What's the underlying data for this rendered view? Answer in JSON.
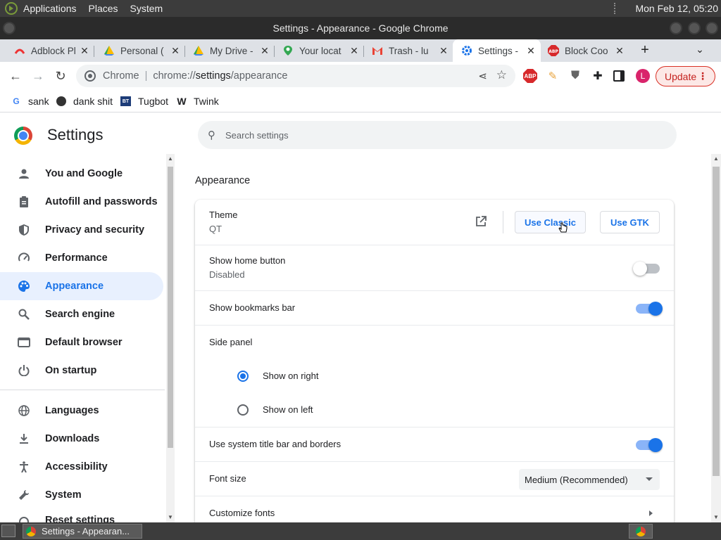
{
  "desktop": {
    "menus": [
      "Applications",
      "Places",
      "System"
    ],
    "clock": "Mon Feb 12, 05:20"
  },
  "window": {
    "title": "Settings - Appearance - Google Chrome"
  },
  "tabs": [
    {
      "label": "Adblock Pl",
      "icon": "adblock-icon"
    },
    {
      "label": "Personal (",
      "icon": "drive-icon"
    },
    {
      "label": "My Drive -",
      "icon": "drive-icon"
    },
    {
      "label": "Your locat",
      "icon": "maps-icon"
    },
    {
      "label": "Trash - lu",
      "icon": "gmail-icon"
    },
    {
      "label": "Settings -",
      "icon": "gear-icon",
      "active": true
    },
    {
      "label": "Block Coo",
      "icon": "abp-icon"
    }
  ],
  "toolbar": {
    "site_name": "Chrome",
    "url_scheme": "chrome://",
    "url_host": "settings",
    "url_path": "/appearance",
    "update_label": "Update",
    "avatar_letter": "L"
  },
  "bookmarks": [
    {
      "label": "sank",
      "icon": "google-icon"
    },
    {
      "label": "dank shit",
      "icon": "generic-icon"
    },
    {
      "label": "Tugbot",
      "icon": "bt-icon"
    },
    {
      "label": "Twink",
      "icon": "w-icon"
    }
  ],
  "settings": {
    "title": "Settings",
    "search_placeholder": "Search settings",
    "nav": [
      {
        "label": "You and Google",
        "icon": "person-icon"
      },
      {
        "label": "Autofill and passwords",
        "icon": "clipboard-icon"
      },
      {
        "label": "Privacy and security",
        "icon": "shield-icon"
      },
      {
        "label": "Performance",
        "icon": "speedometer-icon"
      },
      {
        "label": "Appearance",
        "icon": "palette-icon",
        "active": true
      },
      {
        "label": "Search engine",
        "icon": "search-icon"
      },
      {
        "label": "Default browser",
        "icon": "browser-icon"
      },
      {
        "label": "On startup",
        "icon": "power-icon"
      },
      {
        "label": "Languages",
        "icon": "globe-icon"
      },
      {
        "label": "Downloads",
        "icon": "download-icon"
      },
      {
        "label": "Accessibility",
        "icon": "accessibility-icon"
      },
      {
        "label": "System",
        "icon": "wrench-icon"
      },
      {
        "label": "Reset settings",
        "icon": "reset-icon"
      }
    ],
    "section_title": "Appearance",
    "theme": {
      "label": "Theme",
      "value": "QT",
      "btn_classic": "Use Classic",
      "btn_gtk": "Use GTK"
    },
    "home_button": {
      "label": "Show home button",
      "value": "Disabled",
      "enabled": false
    },
    "bookmarks_bar": {
      "label": "Show bookmarks bar",
      "enabled": true
    },
    "side_panel": {
      "label": "Side panel",
      "options": [
        "Show on right",
        "Show on left"
      ],
      "selected": "Show on right"
    },
    "title_bar": {
      "label": "Use system title bar and borders",
      "enabled": true
    },
    "font_size": {
      "label": "Font size",
      "value": "Medium (Recommended)"
    },
    "customize_fonts": {
      "label": "Customize fonts"
    }
  },
  "taskbar": {
    "item_label": "Settings - Appearan..."
  },
  "colors": {
    "accent": "#1a73e8",
    "active_nav_bg": "#e8f0fe",
    "update_red": "#d93025"
  }
}
